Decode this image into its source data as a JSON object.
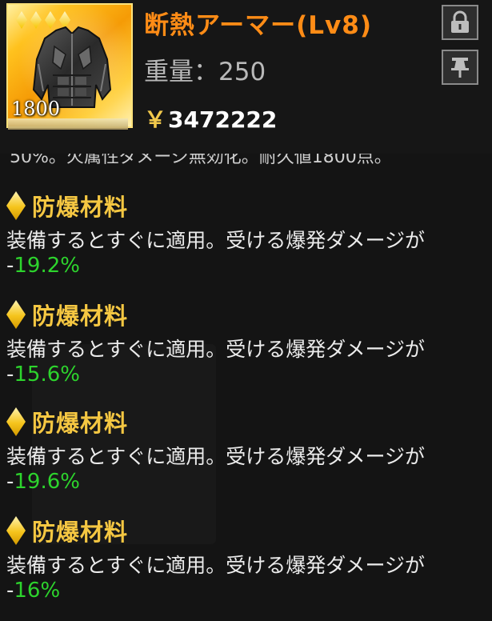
{
  "item": {
    "name": "断熱アーマー(Lv8)",
    "weight": "重量：250",
    "price_symbol": "￥",
    "price": "3472222",
    "rarity_number": "1800",
    "star_count": 4,
    "icon": "armor-jacket-icon"
  },
  "buttons": {
    "lock_icon": "lock-icon",
    "pin_icon": "pin-icon"
  },
  "cut_off_text": "50%。火属性ダメージ無効化。耐久値1800点。",
  "effects": [
    {
      "name": "防爆材料",
      "desc": "装備するとすぐに適用。受ける爆発ダメージが",
      "sign": "-",
      "value": "19.2%"
    },
    {
      "name": "防爆材料",
      "desc": "装備するとすぐに適用。受ける爆発ダメージが",
      "sign": "-",
      "value": "15.6%"
    },
    {
      "name": "防爆材料",
      "desc": "装備するとすぐに適用。受ける爆発ダメージが",
      "sign": "-",
      "value": "19.6%"
    },
    {
      "name": "防爆材料",
      "desc": "装備するとすぐに適用。受ける爆発ダメージが",
      "sign": "-",
      "value": "16%"
    }
  ],
  "colors": {
    "name": "#ff8c16",
    "effect_title": "#f5c742",
    "value_green": "#2dd42d",
    "background": "#141414"
  }
}
